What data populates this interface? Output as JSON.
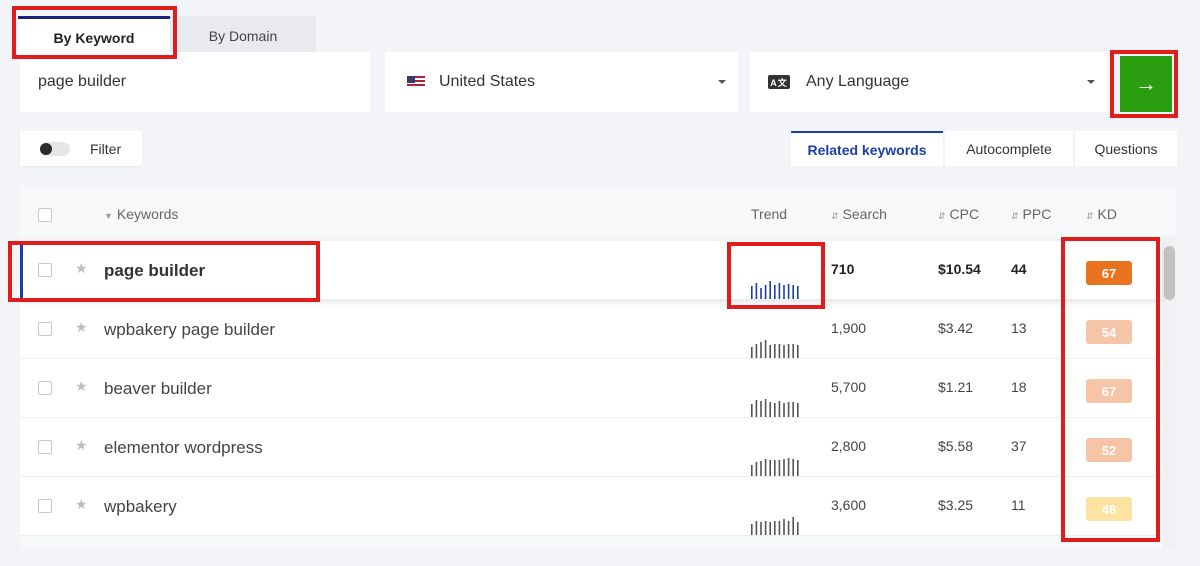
{
  "tabs": [
    {
      "label": "By Keyword",
      "active": true
    },
    {
      "label": "By Domain",
      "active": false
    }
  ],
  "search": {
    "keyword_value": "page builder",
    "country": "United States",
    "language": "Any Language",
    "go_icon": "arrow-right-icon"
  },
  "filter": {
    "label": "Filter",
    "enabled": false
  },
  "modes": [
    {
      "label": "Related keywords",
      "active": true
    },
    {
      "label": "Autocomplete",
      "active": false
    },
    {
      "label": "Questions",
      "active": false
    }
  ],
  "table": {
    "headers": {
      "keywords": "Keywords",
      "trend": "Trend",
      "search": "Search",
      "cpc": "CPC",
      "ppc": "PPC",
      "kd": "KD"
    },
    "rows": [
      {
        "keyword": "page builder",
        "search": "710",
        "cpc": "$10.54",
        "ppc": "44",
        "kd": "67",
        "kd_color": "#e8731f",
        "trend": [
          0.7,
          0.9,
          0.6,
          0.8,
          1,
          0.8,
          0.9,
          0.75,
          0.85,
          0.8,
          0.7
        ],
        "active": true
      },
      {
        "keyword": "wpbakery page builder",
        "search": "1,900",
        "cpc": "$3.42",
        "ppc": "13",
        "kd": "54",
        "kd_color": "#f6c4a6",
        "trend": [
          0.6,
          0.8,
          0.9,
          1,
          0.7,
          0.75,
          0.8,
          0.7,
          0.8,
          0.8,
          0.7
        ],
        "active": false
      },
      {
        "keyword": "beaver builder",
        "search": "5,700",
        "cpc": "$1.21",
        "ppc": "18",
        "kd": "67",
        "kd_color": "#f6c4a6",
        "trend": [
          0.7,
          0.95,
          0.9,
          1,
          0.85,
          0.8,
          0.9,
          0.8,
          0.85,
          0.85,
          0.75
        ],
        "active": false
      },
      {
        "keyword": "elementor wordpress",
        "search": "2,800",
        "cpc": "$5.58",
        "ppc": "37",
        "kd": "52",
        "kd_color": "#f6c4a6",
        "trend": [
          0.6,
          0.8,
          0.85,
          0.95,
          0.9,
          0.9,
          0.9,
          0.95,
          1,
          0.95,
          0.9
        ],
        "active": false
      },
      {
        "keyword": "wpbakery",
        "search": "3,600",
        "cpc": "$3.25",
        "ppc": "11",
        "kd": "48",
        "kd_color": "#fde3a2",
        "trend": [
          0.6,
          0.75,
          0.7,
          0.8,
          0.7,
          0.8,
          0.75,
          0.9,
          0.8,
          1,
          0.7
        ],
        "active": false
      }
    ]
  }
}
